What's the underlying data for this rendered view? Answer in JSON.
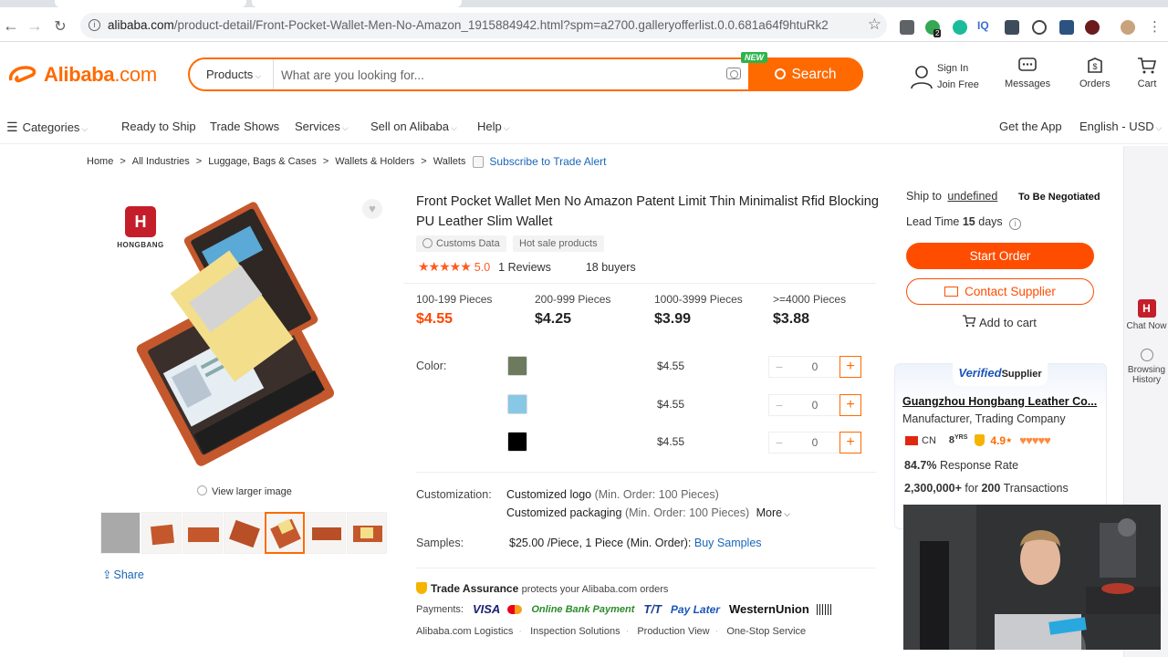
{
  "browser": {
    "url_host": "alibaba.com",
    "url_path": "/product-detail/Front-Pocket-Wallet-Men-No-Amazon_1915884942.html?spm=a2700.galleryofferlist.0.0.681a64f9htuRk2",
    "extension_badge": "2"
  },
  "header": {
    "logo_text": "Alibaba",
    "logo_suffix": ".com",
    "products_label": "Products",
    "search_placeholder": "What are you looking for...",
    "new_badge": "NEW",
    "search_button": "Search",
    "sign_in": "Sign In",
    "join_free": "Join Free",
    "messages": "Messages",
    "orders": "Orders",
    "cart": "Cart"
  },
  "nav": {
    "categories": "Categories",
    "items": [
      "Ready to Ship",
      "Trade Shows",
      "Services",
      "Sell on Alibaba",
      "Help"
    ],
    "get_app": "Get the App",
    "lang": "English - USD"
  },
  "breadcrumb": {
    "items": [
      "Home",
      "All Industries",
      "Luggage, Bags & Cases",
      "Wallets & Holders",
      "Wallets"
    ],
    "alert": "Subscribe to Trade Alert"
  },
  "gallery": {
    "brand_name": "HONGBANG",
    "view_larger": "View larger image",
    "share": "Share"
  },
  "product": {
    "title": "Front Pocket Wallet Men No Amazon Patent Limit Thin Minimalist Rfid Blocking PU Leather Slim Wallet",
    "tags": [
      "Customs Data",
      "Hot sale products"
    ],
    "rating": "5.0",
    "reviews": "1 Reviews",
    "buyers": "18 buyers",
    "tiers": [
      {
        "range": "100-199 Pieces",
        "price": "$4.55"
      },
      {
        "range": "200-999 Pieces",
        "price": "$4.25"
      },
      {
        "range": "1000-3999 Pieces",
        "price": "$3.99"
      },
      {
        "range": ">=4000 Pieces",
        "price": "$3.88"
      }
    ],
    "color_label": "Color:",
    "variants": [
      {
        "color": "#6d7a5e",
        "price": "$4.55",
        "qty": "0"
      },
      {
        "color": "#88c8e6",
        "price": "$4.55",
        "qty": "0"
      },
      {
        "color": "#000000",
        "price": "$4.55",
        "qty": "0"
      }
    ],
    "customization_label": "Customization:",
    "custom_logo": "Customized logo",
    "custom_logo_min": "(Min. Order: 100 Pieces)",
    "custom_pack": "Customized packaging",
    "custom_pack_min": "(Min. Order: 100 Pieces)",
    "more": "More",
    "samples_label": "Samples:",
    "samples_value": "$25.00 /Piece, 1 Piece (Min. Order):",
    "buy_samples": "Buy Samples",
    "trade_assurance": "Trade Assurance",
    "trade_assurance_desc": "protects your Alibaba.com orders",
    "payments_label": "Payments:",
    "payment_methods": [
      "VISA",
      "Online Bank Payment",
      "T/T",
      "Pay Later",
      "WesternUnion"
    ],
    "services": [
      "Alibaba.com Logistics",
      "Inspection Solutions",
      "Production View",
      "One-Stop Service"
    ]
  },
  "order_panel": {
    "ship_to": "Ship to",
    "ship_dest": "undefined",
    "negotiated": "To Be Negotiated",
    "lead_time_label": "Lead Time",
    "lead_time_value": "15",
    "lead_time_unit": "days",
    "start_order": "Start Order",
    "contact_supplier": "Contact Supplier",
    "add_to_cart": "Add to cart"
  },
  "supplier": {
    "verified_prefix": "Verified",
    "verified_suffix": "Supplier",
    "name": "Guangzhou Hongbang Leather Co...",
    "type": "Manufacturer, Trading Company",
    "country": "CN",
    "years": "8",
    "years_unit": "YRS",
    "score": "4.9",
    "response_rate": "84.7%",
    "response_label": "Response Rate",
    "transactions_value": "2,300,000+",
    "transactions_for": "for",
    "transactions_count": "200",
    "transactions_label": "Transactions"
  },
  "sidebar": {
    "chat_now": "Chat Now",
    "browsing_history": "Browsing History"
  }
}
